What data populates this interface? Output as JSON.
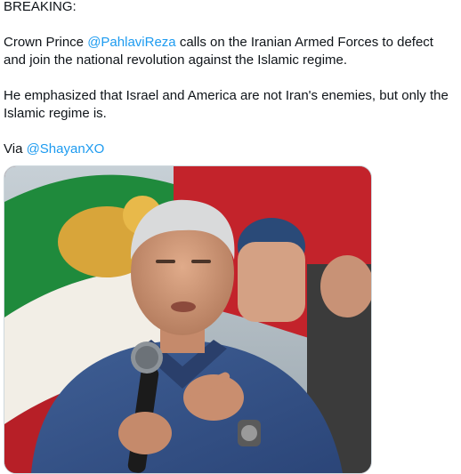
{
  "tweet": {
    "heading": "BREAKING:",
    "para1": {
      "before": "Crown Prince ",
      "mention": "@PahlaviReza",
      "after": " calls on the Iranian Armed Forces to defect and join the national revolution against the Islamic regime."
    },
    "para2": "He emphasized that Israel and America are not Iran's enemies, but only the Islamic regime is.",
    "via": {
      "prefix": "Via ",
      "mention": "@ShayanXO"
    }
  },
  "colors": {
    "link": "#1d9bf0",
    "text": "#0f1419",
    "media_border": "#cfd9de"
  },
  "media": {
    "alt": "Man in a blue zip sweater speaking into a microphone in front of a green, white and red lion-and-sun flag"
  }
}
